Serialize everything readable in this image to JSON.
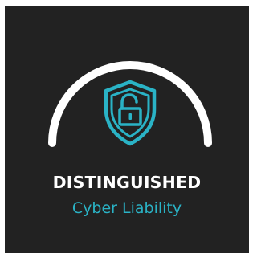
{
  "badge": {
    "title": "DISTINGUISHED",
    "subtitle": "Cyber Liability",
    "icon": "shield-unlocked-padlock-icon",
    "colors": {
      "background": "#222222",
      "arc": "#ffffff",
      "accent": "#2ab3c6",
      "title_text": "#ffffff"
    }
  }
}
